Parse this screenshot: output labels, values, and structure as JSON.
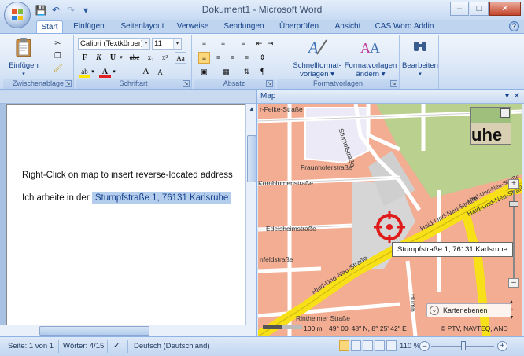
{
  "window": {
    "title": "Dokument1 - Microsoft Word",
    "quick_access": [
      "save-icon",
      "undo-icon",
      "redo-icon",
      "customize-icon"
    ]
  },
  "tabs": [
    {
      "label": "Start",
      "active": true
    },
    {
      "label": "Einfügen"
    },
    {
      "label": "Seitenlayout"
    },
    {
      "label": "Verweise"
    },
    {
      "label": "Sendungen"
    },
    {
      "label": "Überprüfen"
    },
    {
      "label": "Ansicht"
    },
    {
      "label": "CAS Word Addin"
    }
  ],
  "ribbon": {
    "clipboard": {
      "paste_label": "Einfügen",
      "group_label": "Zwischenablage"
    },
    "font": {
      "family": "Calibri (Textkörper)",
      "size": "11",
      "group_label": "Schriftart",
      "bold": "F",
      "italic": "K",
      "underline": "U",
      "strike": "abc",
      "subscript": "x₂",
      "superscript": "x²",
      "clear": "Aa",
      "grow": "A",
      "shrink": "A"
    },
    "paragraph": {
      "group_label": "Absatz"
    },
    "styles": {
      "quick_label_1": "Schnellformat-",
      "quick_label_2": "vorlagen",
      "change_label_1": "Formatvorlagen",
      "change_label_2": "ändern",
      "group_label": "Formatvorlagen"
    },
    "editing": {
      "label": "Bearbeiten"
    }
  },
  "document": {
    "line1": "Right-Click on map to insert reverse-located address",
    "line2_prefix": "Ich arbeite in der",
    "line2_selected": "Stumpfstraße 1, 76131 Karlsruhe"
  },
  "map": {
    "panel_title": "Map",
    "overview_text": "uhe",
    "tooltip": "Stumpfstraße 1, 76131 Karlsruhe",
    "layers_label": "Kartenebenen",
    "scale_label": "100 m",
    "coords": "49° 00' 48\" N, 8° 25' 42\" E",
    "copyright": "© PTV, NAVTEQ, AND",
    "streets": {
      "felke": "r-Felke-Straße",
      "stumpf": "Stumpfstraße",
      "fraunhofer": "Fraunhoferstraße",
      "kornblumen": "Kornblumenstraße",
      "edelsheim": "Edelsheimstraße",
      "hirsch": "nfeldstraße",
      "haid1": "Haid-Und-Neu-Straße",
      "haid2": "Haid-Und-Neu-Straße",
      "haid3": "Haid-Und-Neu-Straße",
      "haid4": "Haid-Und-Neu-Straße",
      "rintheimer": "Rintheimer Straße",
      "humb": "Humb"
    }
  },
  "status": {
    "page": "Seite: 1 von 1",
    "words": "Wörter: 4/15",
    "language": "Deutsch (Deutschland)",
    "zoom": "110 %"
  }
}
